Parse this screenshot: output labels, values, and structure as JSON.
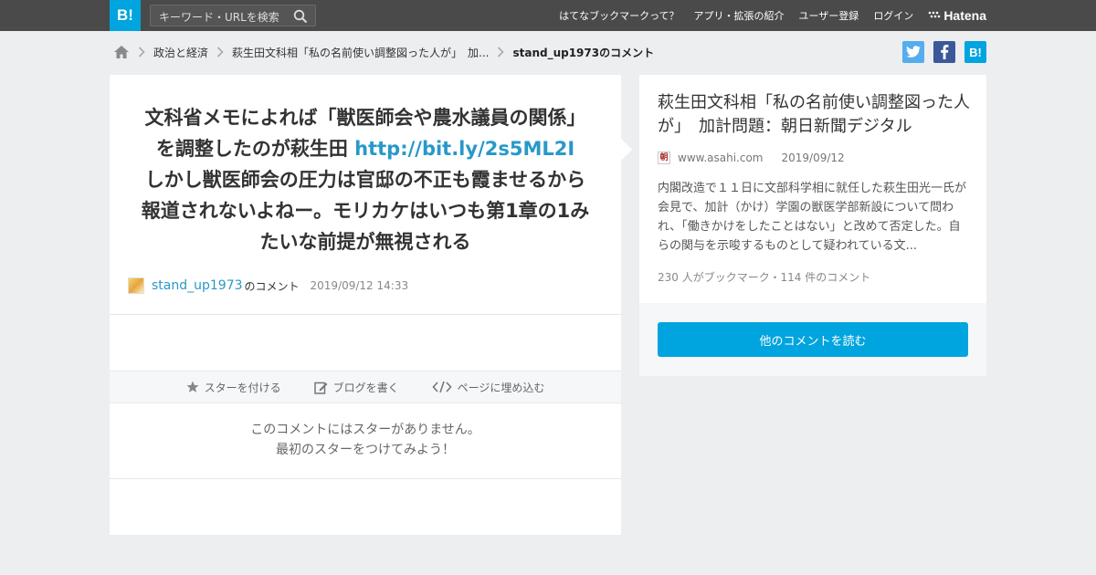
{
  "header": {
    "logo_text": "B!",
    "search_placeholder": "キーワード・URLを検索",
    "nav": [
      "はてなブックマークって？",
      "アプリ・拡張の紹介",
      "ユーザー登録",
      "ログイン"
    ],
    "brand": "Hatena"
  },
  "breadcrumb": {
    "items": [
      "政治と経済",
      "萩生田文科相「私の名前使い調整図った人が」　加...",
      "stand_up1973のコメント"
    ]
  },
  "share": {
    "twitter": "t",
    "facebook": "f",
    "hatena": "B!"
  },
  "comment": {
    "text_before_link": "文科省メモによれば「獣医師会や農水議員の関係」を調整したのが萩生田 ",
    "link": "http://bit.ly/2s5ML2I",
    "text_after_link": "しかし獣医師会の圧力は官邸の不正も霞ませるから報道されないよねー。モリカケはいつも第1章の1みたいな前提が無視される",
    "user": "stand_up1973",
    "user_suffix": "のコメント",
    "timestamp": "2019/09/12 14:33"
  },
  "actions": {
    "star": "スターを付ける",
    "blog": "ブログを書く",
    "embed": "ページに埋め込む"
  },
  "stars": {
    "line1": "このコメントにはスターがありません。",
    "line2": "最初のスターをつけてみよう！"
  },
  "entry": {
    "title": "萩生田文科相「私の名前使い調整図った人が」　加計問題：朝日新聞デジタル",
    "favicon_text": "朝",
    "domain": "www.asahi.com",
    "date": "2019/09/12",
    "description": "内閣改造で１１日に文部科学相に就任した萩生田光一氏が会見で、加計（かけ）学園の獣医学部新設について問われ、「働きかけをしたことはない」と改めて否定した。自らの関与を示唆するものとして疑われている文...",
    "counts": "230 人がブックマーク・114 件のコメント",
    "more_button": "他のコメントを読む"
  },
  "colors": {
    "brand_blue": "#00a4de",
    "link_blue": "#2898c9",
    "topbar": "#4a4a4a"
  }
}
